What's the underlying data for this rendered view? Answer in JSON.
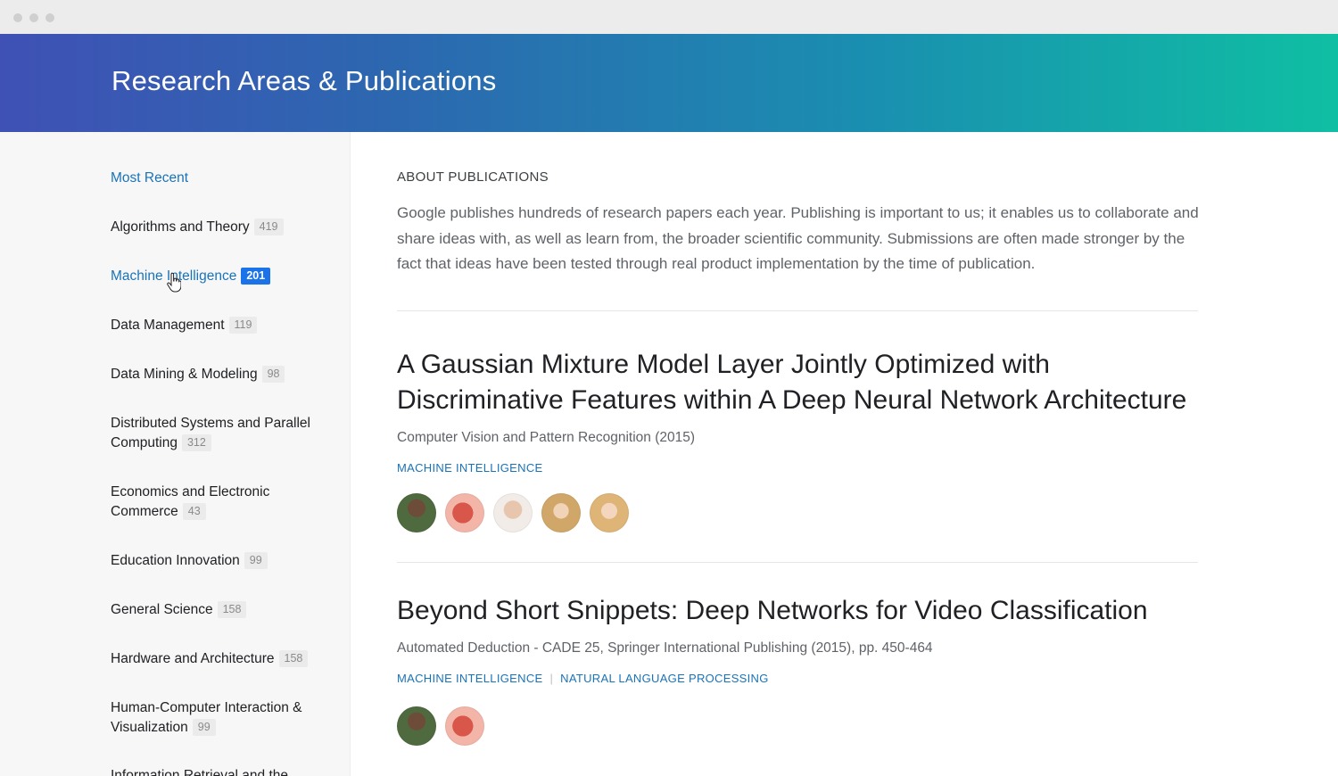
{
  "header": {
    "title": "Research Areas & Publications"
  },
  "sidebar": {
    "items": [
      {
        "label": "Most Recent",
        "count": "",
        "link": true
      },
      {
        "label": "Algorithms and Theory",
        "count": "419"
      },
      {
        "label": "Machine Intelligence",
        "count": "201",
        "active": true
      },
      {
        "label": "Data Management",
        "count": "119"
      },
      {
        "label": "Data Mining & Modeling",
        "count": "98"
      },
      {
        "label": "Distributed Systems and Parallel Computing",
        "count": "312"
      },
      {
        "label": "Economics and Electronic Commerce",
        "count": "43"
      },
      {
        "label": "Education Innovation",
        "count": "99"
      },
      {
        "label": "General Science",
        "count": "158"
      },
      {
        "label": "Hardware and Architecture",
        "count": "158"
      },
      {
        "label": "Human-Computer Interaction & Visualization",
        "count": "99"
      },
      {
        "label": "Information Retrieval and the",
        "count": ""
      }
    ]
  },
  "about": {
    "heading": "ABOUT PUBLICATIONS",
    "text": "Google publishes hundreds of research papers each year. Publishing is important to us; it enables us to collaborate and share ideas with, as well as learn from, the broader scientific community. Submissions are often made stronger by the fact that ideas have been tested through real product implementation by the time of publication."
  },
  "publications": [
    {
      "title": "A Gaussian Mixture Model Layer Jointly Optimized with Discriminative Features within A Deep Neural Network Architecture",
      "venue": "Computer Vision and Pattern Recognition (2015)",
      "tags": [
        "MACHINE INTELLIGENCE"
      ],
      "author_avatar_colors": [
        "#5b6b4a",
        "#e07a6a",
        "#d9c4b4",
        "#c9a77a",
        "#e2c08e"
      ]
    },
    {
      "title": "Beyond Short Snippets: Deep Networks for Video Classification",
      "venue": "Automated Deduction - CADE 25, Springer International Publishing (2015), pp. 450-464",
      "tags": [
        "MACHINE INTELLIGENCE",
        "NATURAL LANGUAGE PROCESSING"
      ],
      "author_avatar_colors": [
        "#5b6b4a",
        "#e07a6a"
      ]
    }
  ],
  "colors": {
    "link": "#1a73b8",
    "active_badge": "#1a73e8",
    "header_gradient": [
      "#3f51b5",
      "#0fbfa3"
    ]
  }
}
